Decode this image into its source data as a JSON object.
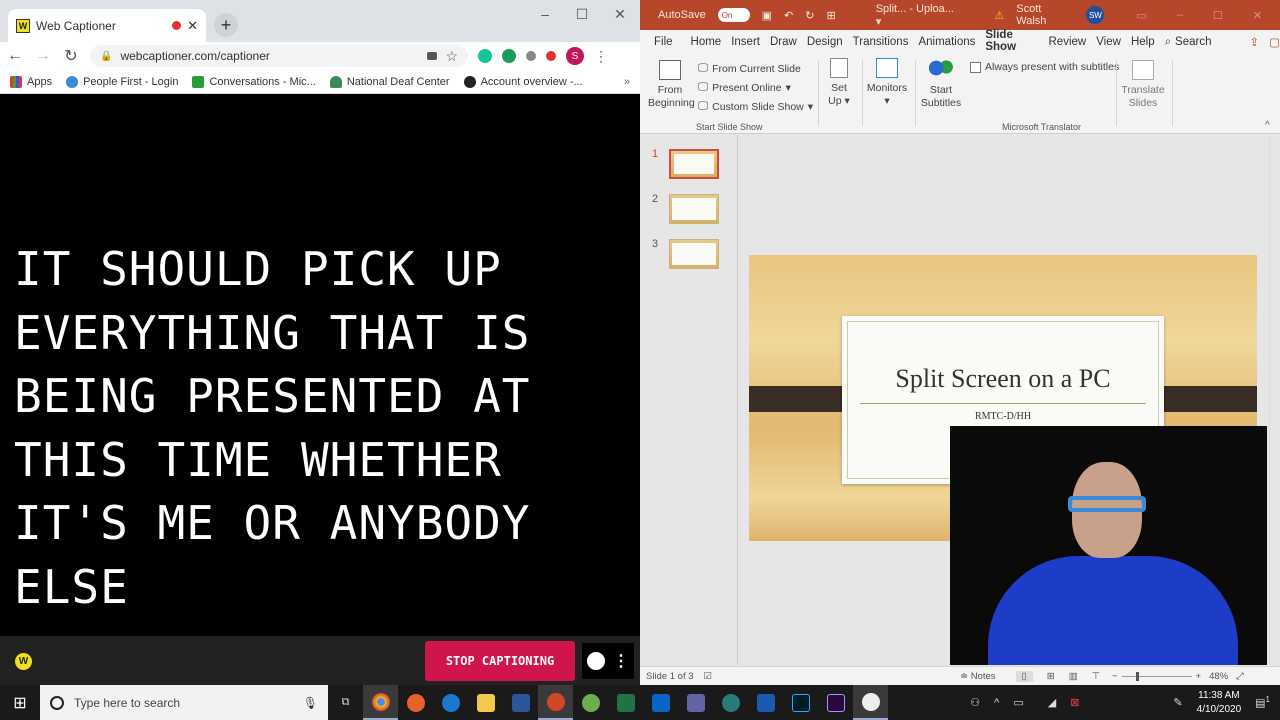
{
  "chrome": {
    "tab_title": "Web Captioner",
    "url": "webcaptioner.com/captioner",
    "profile_initial": "S",
    "bookmarks": [
      "Apps",
      "People First - Login",
      "Conversations - Mic...",
      "National Deaf Center",
      "Account overview -..."
    ],
    "overflow": "»"
  },
  "captioner": {
    "caption_text": "IT SHOULD PICK UP\nEVERYTHING THAT IS\nBEING PRESENTED AT\nTHIS TIME WHETHER\nIT'S ME OR ANYBODY\nELSE",
    "logo_letter": "W",
    "stop_button": "STOP CAPTIONING",
    "accent": "#d0144c"
  },
  "powerpoint": {
    "autosave_label": "AutoSave",
    "autosave_state": "On",
    "doc_title": "Split... - Uploa... ▾",
    "user_name": "Scott Walsh",
    "user_initials": "SW",
    "ribbon_tabs": [
      "File",
      "Home",
      "Insert",
      "Draw",
      "Design",
      "Transitions",
      "Animations",
      "Slide Show",
      "Review",
      "View",
      "Help",
      "Search"
    ],
    "active_tab": "Slide Show",
    "ribbon": {
      "from_beginning": "From Beginning",
      "from_current": "From Current Slide",
      "present_online": "Present Online",
      "custom_show": "Custom Slide Show",
      "group_start": "Start Slide Show",
      "set_up": "Set Up",
      "monitors": "Monitors",
      "start_subtitles": "Start Subtitles",
      "always_subtitles": "Always present with subtitles",
      "translate_slides": "Translate Slides",
      "group_translator": "Microsoft Translator"
    },
    "thumbnails": [
      "1",
      "2",
      "3"
    ],
    "slide": {
      "title": "Split Screen on a PC",
      "subtitle": "RMTC-D/HH"
    },
    "status": {
      "slide_counter": "Slide 1 of 3",
      "notes": "Notes",
      "zoom": "48%"
    },
    "brand_color": "#b7472a"
  },
  "taskbar": {
    "search_placeholder": "Type here to search",
    "time": "11:38 AM",
    "date": "4/10/2020",
    "notification_count": "1"
  }
}
